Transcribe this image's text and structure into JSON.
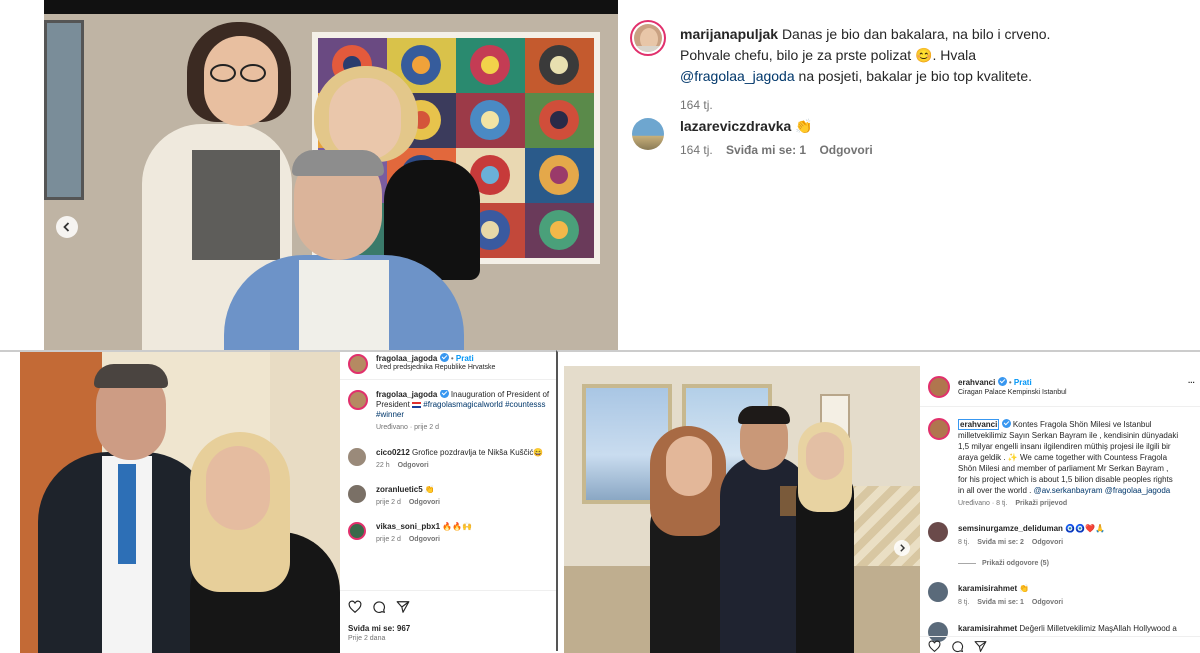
{
  "top_post": {
    "author": "marijanapuljak",
    "caption_1": "Danas je bio dan bakalara, na bilo i crveno.",
    "caption_2": "Pohvale chefu, bilo je za prste polizat",
    "caption_emoji": "😊",
    "caption_3": ". Hvala",
    "mention": "@fragolaa_jagoda",
    "caption_4": " na posjeti, bakalar je bio top kvalitete.",
    "time": "164 tj.",
    "comment": {
      "user": "lazareviczdravka",
      "emoji": "👏",
      "time": "164 tj.",
      "likes": "Sviđa mi se: 1",
      "reply": "Odgovori"
    }
  },
  "bottom_left_post": {
    "header_user": "fragolaa_jagoda",
    "follow": "Prati",
    "location": "Ured predsjednika Republike Hrvatske",
    "caption_user": "fragolaa_jagoda",
    "caption_text": "Inauguration of President of",
    "caption_text2": "President",
    "hashtags": "#fragolasmagicalworld #countesss",
    "hashtag_winner": "#winner",
    "edited": "Uređivano · prije 2 d",
    "comments": [
      {
        "user": "cico0212",
        "text": "Grofice pozdravlja te Nikša Kuščić😄",
        "time": "22 h",
        "reply": "Odgovori"
      },
      {
        "user": "zoranluetic5",
        "text": "👏",
        "time": "prije 2 d",
        "reply": "Odgovori"
      },
      {
        "user": "vikas_soni_pbx1",
        "text": "🔥🔥🙌",
        "time": "prije 2 d",
        "reply": "Odgovori"
      }
    ],
    "likes": "Sviđa mi se: 967",
    "ago": "Prije 2 dana"
  },
  "bottom_right_post": {
    "header_user": "erahvanci",
    "follow": "Prati",
    "location": "Ciragan Palace Kempinski Istanbul",
    "more": "...",
    "caption_user": "erahvanci",
    "caption_lines": [
      "Kontes Fragola Shön Milesi ve Istanbul",
      "milletvekilimiz Sayın Serkan Bayram ile , kendisinin dünyadaki",
      "1,5 milyar engelli insanı ilgilendiren müthiş projesi ile ilgili bir",
      "araya geldik . ✨ We came together with Countess Fragola",
      "Shön Milesi and member of parliament Mr Serkan Bayram ,",
      "for his project which is about 1,5 bilion disable peoples rights",
      "in all over the world ."
    ],
    "caption_mentions": "@av.serkanbayram @fragolaa_jagoda",
    "edited": "Uređivano · 8 tj.",
    "translate": "Prikaži prijevod",
    "comments": [
      {
        "user": "semsinurgamze_deliduman",
        "text": "🧿🧿❤️🙏",
        "time": "8 tj.",
        "likes": "Sviđa mi se: 2",
        "reply": "Odgovori"
      },
      {
        "user": "karamisirahmet",
        "text": "👏",
        "time": "8 tj.",
        "likes": "Sviđa mi se: 1",
        "reply": "Odgovori"
      },
      {
        "user": "karamisirahmet",
        "text": "Değerli Milletvekilimiz MaşAllah Hollywood a",
        "time": "",
        "likes": "",
        "reply": ""
      }
    ],
    "show_replies": "Prikaži odgovore (5)"
  },
  "colors": {
    "link": "#00376b",
    "muted": "#737373",
    "verified": "#3897f0"
  }
}
